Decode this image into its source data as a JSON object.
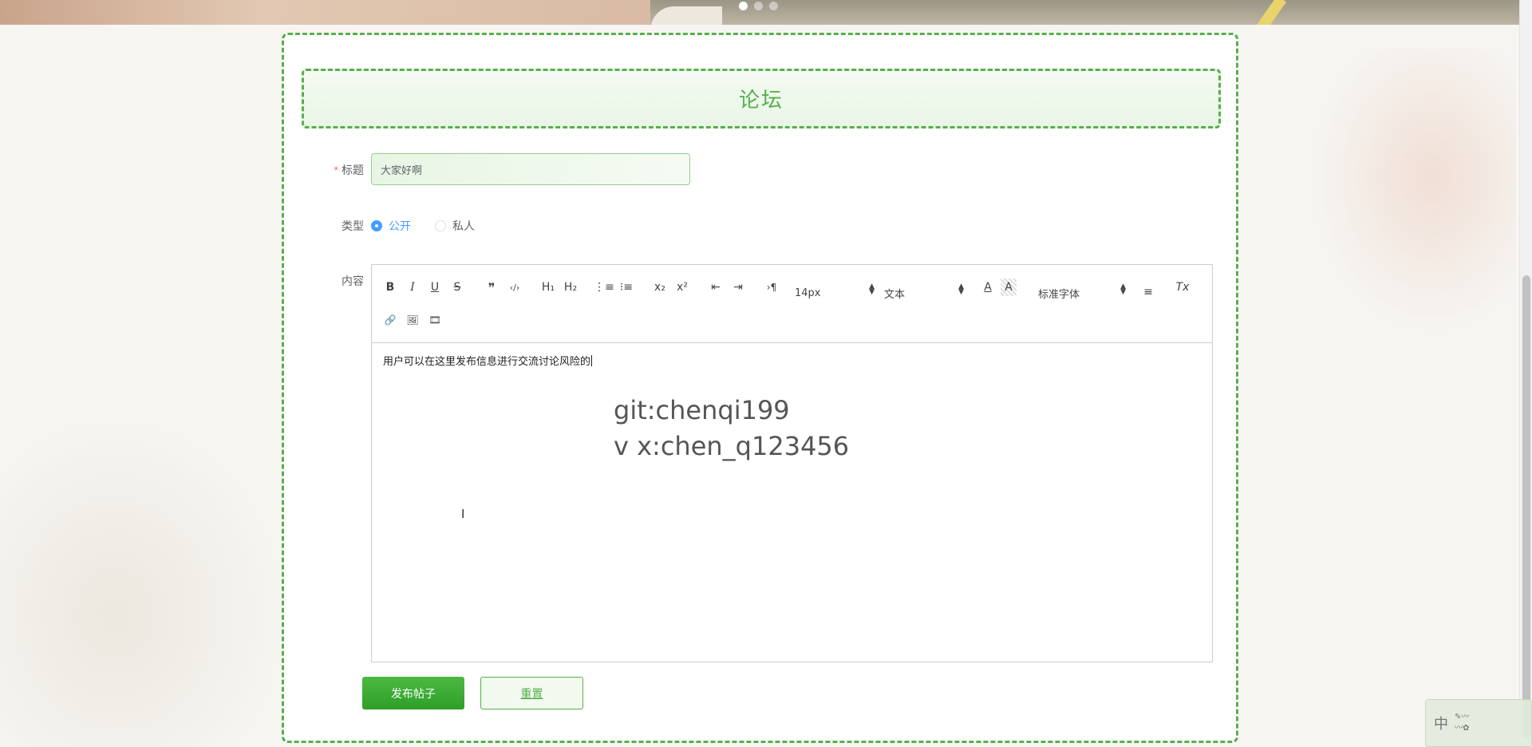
{
  "banner": {
    "slides": [
      "slide-1",
      "slide-2",
      "slide-3"
    ],
    "active_index": 0
  },
  "page": {
    "title": "论坛"
  },
  "form": {
    "title_label": "标题",
    "title_required_mark": "*",
    "title_value": "大家好啊",
    "type_label": "类型",
    "type_options": [
      "公开",
      "私人"
    ],
    "type_selected": "公开",
    "content_label": "内容"
  },
  "editor": {
    "toolbar": {
      "bold": "B",
      "italic": "I",
      "underline": "U",
      "strike": "S",
      "blockquote": "❞",
      "code": "‹/›",
      "h1": "H₁",
      "h2": "H₂",
      "ordered_list": "⋮≡",
      "bullet_list": "⁝≡",
      "subscript": "x₂",
      "superscript": "x²",
      "outdent": "⇤",
      "indent": "⇥",
      "direction": "›¶",
      "size_value": "14px",
      "header_value": "文本",
      "color": "A",
      "background": "A",
      "font_value": "标准字体",
      "align": "≡",
      "clean": "Tx",
      "link": "🔗",
      "image": "🖼",
      "video": "🎞"
    },
    "content": "用户可以在这里发布信息进行交流讨论风险的"
  },
  "watermark": {
    "line1": "git:chenqi199",
    "line2": "v x:chen_q123456"
  },
  "buttons": {
    "submit": "发布帖子",
    "reset": "重置"
  },
  "ime": {
    "label": "中"
  },
  "colors": {
    "accent": "#55b04a",
    "primary_button": "#2e9f2a",
    "radio_checked": "#409eff",
    "required": "#f56c6c"
  }
}
